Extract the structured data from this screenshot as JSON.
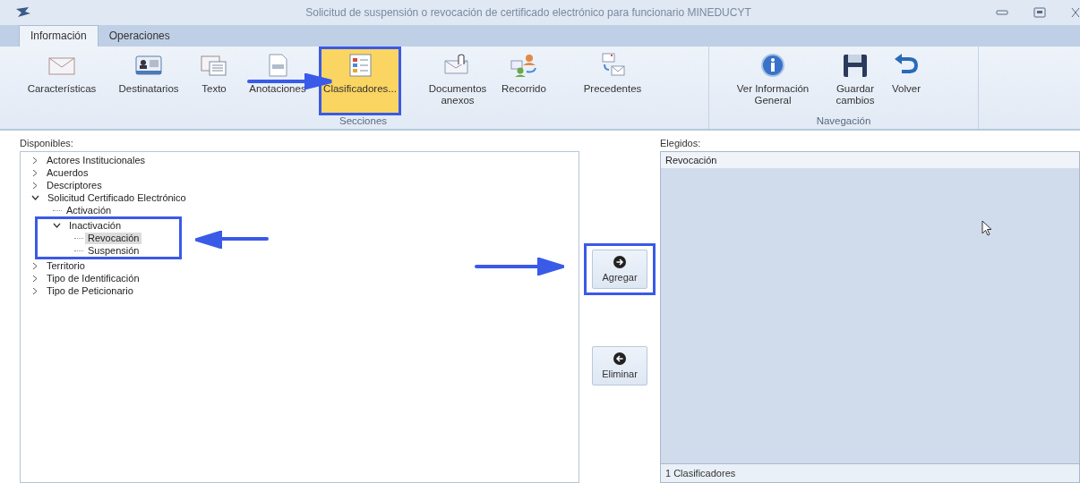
{
  "window": {
    "title": "Solicitud de suspensión o revocación de certificado electrónico para funcionario MINEDUCYT"
  },
  "tabs": [
    {
      "label": "Información",
      "selected": true
    },
    {
      "label": "Operaciones",
      "selected": false
    }
  ],
  "ribbon_groups": [
    {
      "label": "Secciones",
      "items": [
        {
          "label": "Características",
          "selected": false
        },
        {
          "label": "Destinatarios",
          "selected": false
        },
        {
          "label": "Texto",
          "selected": false
        },
        {
          "label": "Anotaciones",
          "selected": false
        },
        {
          "label": "Clasificadores...",
          "selected": true
        },
        {
          "label": "Documentos anexos",
          "selected": false
        },
        {
          "label": "Recorrido",
          "selected": false
        },
        {
          "label": "Precedentes",
          "selected": false
        }
      ]
    },
    {
      "label": "Navegación",
      "items": [
        {
          "label": "Ver Información General",
          "selected": false
        },
        {
          "label": "Guardar cambios",
          "selected": false
        },
        {
          "label": "Volver",
          "selected": false
        }
      ]
    }
  ],
  "available": {
    "label": "Disponibles:",
    "tree": [
      {
        "label": "Actores Institucionales",
        "expanded": false,
        "selected": false
      },
      {
        "label": "Acuerdos",
        "expanded": false,
        "selected": false
      },
      {
        "label": "Descriptores",
        "expanded": false,
        "selected": false
      },
      {
        "label": "Solicitud Certificado Electrónico",
        "expanded": true,
        "selected": false,
        "children": [
          {
            "label": "Activación",
            "selected": false
          },
          {
            "label": "Inactivación",
            "expanded": true,
            "selected": false,
            "children": [
              {
                "label": "Revocación",
                "selected": true
              },
              {
                "label": "Suspensión",
                "selected": false
              }
            ]
          }
        ]
      },
      {
        "label": "Territorio",
        "expanded": false,
        "selected": false
      },
      {
        "label": "Tipo de Identificación",
        "expanded": false,
        "selected": false
      },
      {
        "label": "Tipo de Peticionario",
        "expanded": false,
        "selected": false
      }
    ]
  },
  "buttons": [
    {
      "label": "Agregar",
      "kind": "add"
    },
    {
      "label": "Eliminar",
      "kind": "remove"
    }
  ],
  "chosen": {
    "label": "Elegidos:",
    "items": [
      {
        "label": "Revocación"
      }
    ],
    "footer": "1 Clasificadores"
  }
}
